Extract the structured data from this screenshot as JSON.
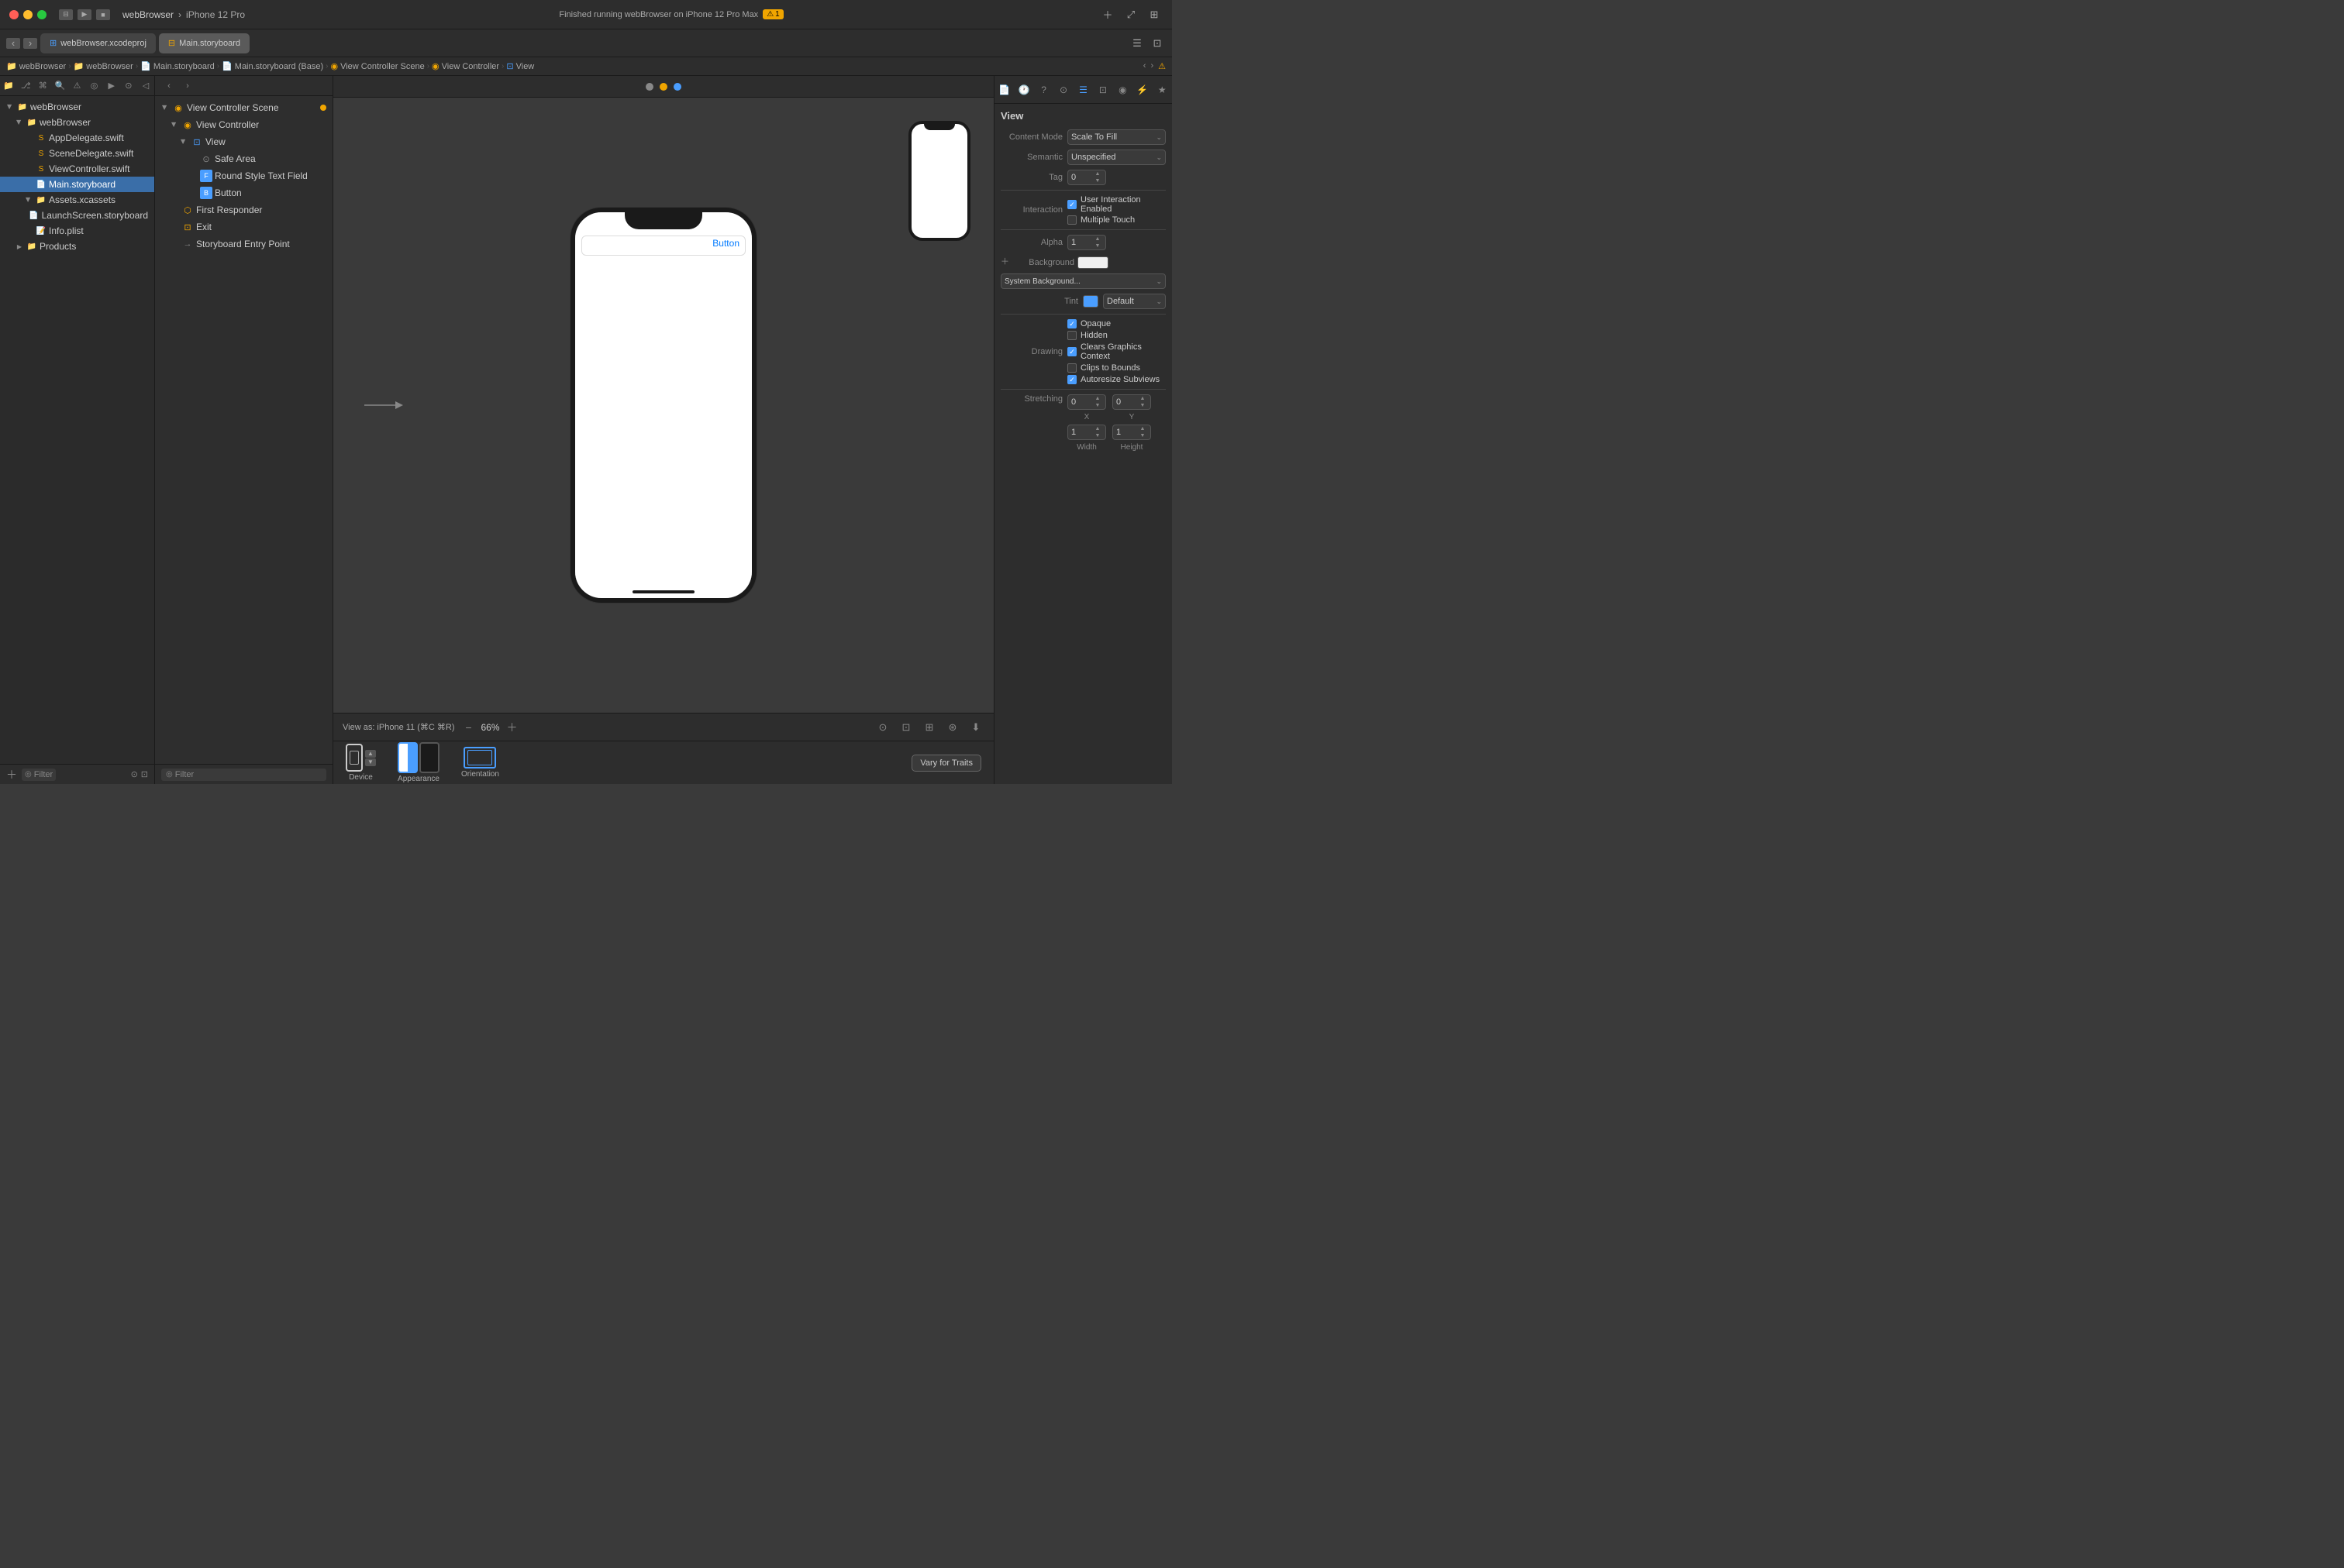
{
  "titleBar": {
    "projectName": "webBrowser",
    "deviceTarget": "iPhone 12 Pro",
    "runStatus": "Finished running webBrowser on iPhone 12 Pro Max",
    "warningCount": "⚠ 1",
    "projectFile": "webBrowser.xcodeproj",
    "storyboard": "Main.storyboard"
  },
  "toolbar": {
    "navBack": "‹",
    "navForward": "›"
  },
  "breadcrumb": {
    "items": [
      "webBrowser",
      "webBrowser",
      "Main.storyboard",
      "Main.storyboard (Base)",
      "View Controller Scene",
      "View Controller",
      "View"
    ]
  },
  "fileNav": {
    "rootGroup": "webBrowser",
    "subGroup": "webBrowser",
    "files": [
      "AppDelegate.swift",
      "SceneDelegate.swift",
      "ViewController.swift",
      "Main.storyboard",
      "Assets.xcassets",
      "LaunchScreen.storyboard",
      "Info.plist",
      "Products"
    ],
    "filterPlaceholder": "Filter"
  },
  "sceneNav": {
    "scene": "View Controller Scene",
    "controller": "View Controller",
    "view": "View",
    "safeArea": "Safe Area",
    "textField": "Round Style Text Field",
    "button": "Button",
    "firstResponder": "First Responder",
    "exit": "Exit",
    "entryPoint": "Storyboard Entry Point",
    "filterPlaceholder": "Filter"
  },
  "canvas": {
    "topBarDots": [
      "dot1",
      "dot2",
      "dot3"
    ],
    "viewAsLabel": "View as: iPhone 11 (⌘C ⌘R)",
    "zoomLevel": "66%",
    "deviceLabel": "Device",
    "appearanceLabel": "Appearance",
    "orientationLabel": "Orientation",
    "varyTraitsBtn": "Vary for Traits",
    "buttonText": "Button"
  },
  "inspector": {
    "panelTitle": "View",
    "contentModeLabel": "Content Mode",
    "contentModeValue": "Scale To Fill",
    "semanticLabel": "Semantic",
    "semanticValue": "Unspecified",
    "tagLabel": "Tag",
    "tagValue": "0",
    "interactionLabel": "Interaction",
    "userInteractionLabel": "User Interaction Enabled",
    "multipleTouchLabel": "Multiple Touch",
    "alphaLabel": "Alpha",
    "alphaValue": "1",
    "backgroundLabel": "Background",
    "backgroundValue": "System Background...",
    "tintLabel": "Tint",
    "tintValue": "Default",
    "drawingLabel": "Drawing",
    "opaqueLabel": "Opaque",
    "hiddenLabel": "Hidden",
    "clearsGraphicsLabel": "Clears Graphics Context",
    "clipsToBoundsLabel": "Clips to Bounds",
    "autoresizeLabel": "Autoresize Subviews",
    "stretchingLabel": "Stretching",
    "stretchingX": "X",
    "stretchingY": "Y",
    "stretchingWidth": "Width",
    "stretchingHeight": "Height",
    "stretchingXVal": "0",
    "stretchingYVal": "0",
    "stretchingWVal": "1",
    "stretchingHVal": "1"
  }
}
